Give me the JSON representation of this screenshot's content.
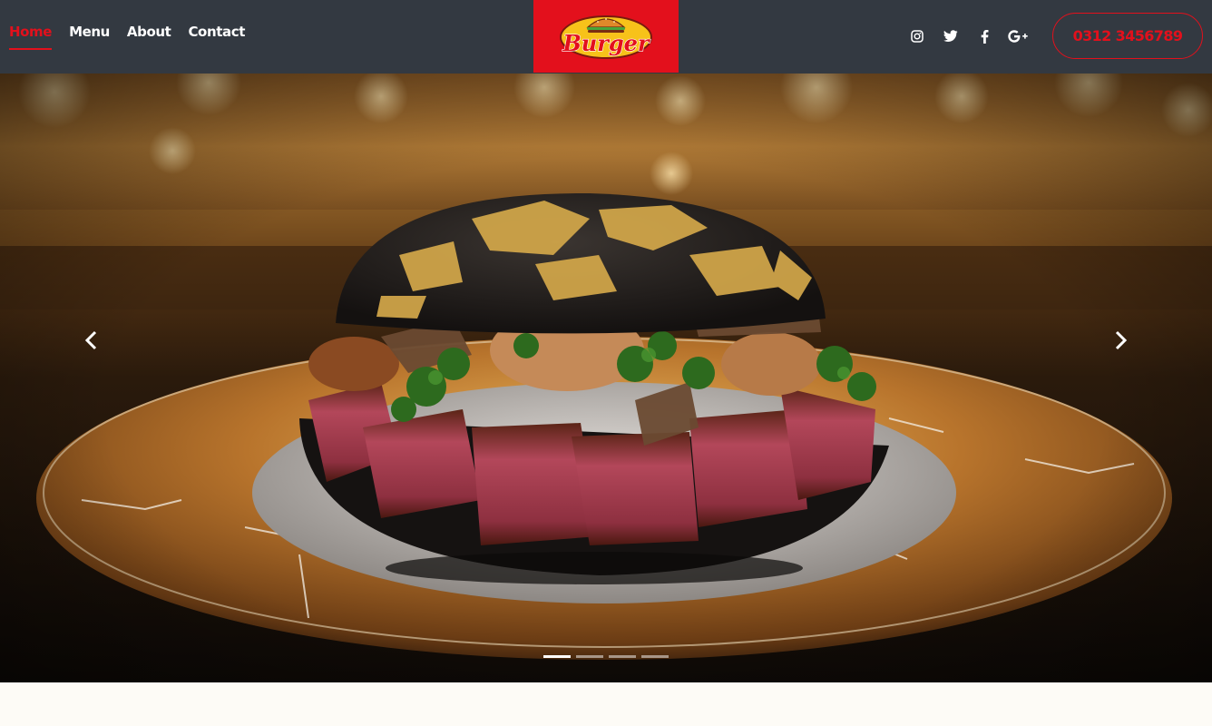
{
  "nav": {
    "items": [
      {
        "label": "Home",
        "active": true
      },
      {
        "label": "Menu",
        "active": false
      },
      {
        "label": "About",
        "active": false
      },
      {
        "label": "Contact",
        "active": false
      }
    ]
  },
  "logo": {
    "text": "Burger",
    "background": "#e3101c"
  },
  "social": [
    "instagram-icon",
    "twitter-icon",
    "facebook-icon",
    "google-plus-icon"
  ],
  "phone": {
    "label": "0312 3456789"
  },
  "carousel": {
    "slide_count": 4,
    "active_index": 0,
    "prev_icon": "chevron-left-icon",
    "next_icon": "chevron-right-icon"
  },
  "colors": {
    "header_bg": "#333941",
    "accent": "#e3101c",
    "page_bg": "#fdfbf6"
  }
}
